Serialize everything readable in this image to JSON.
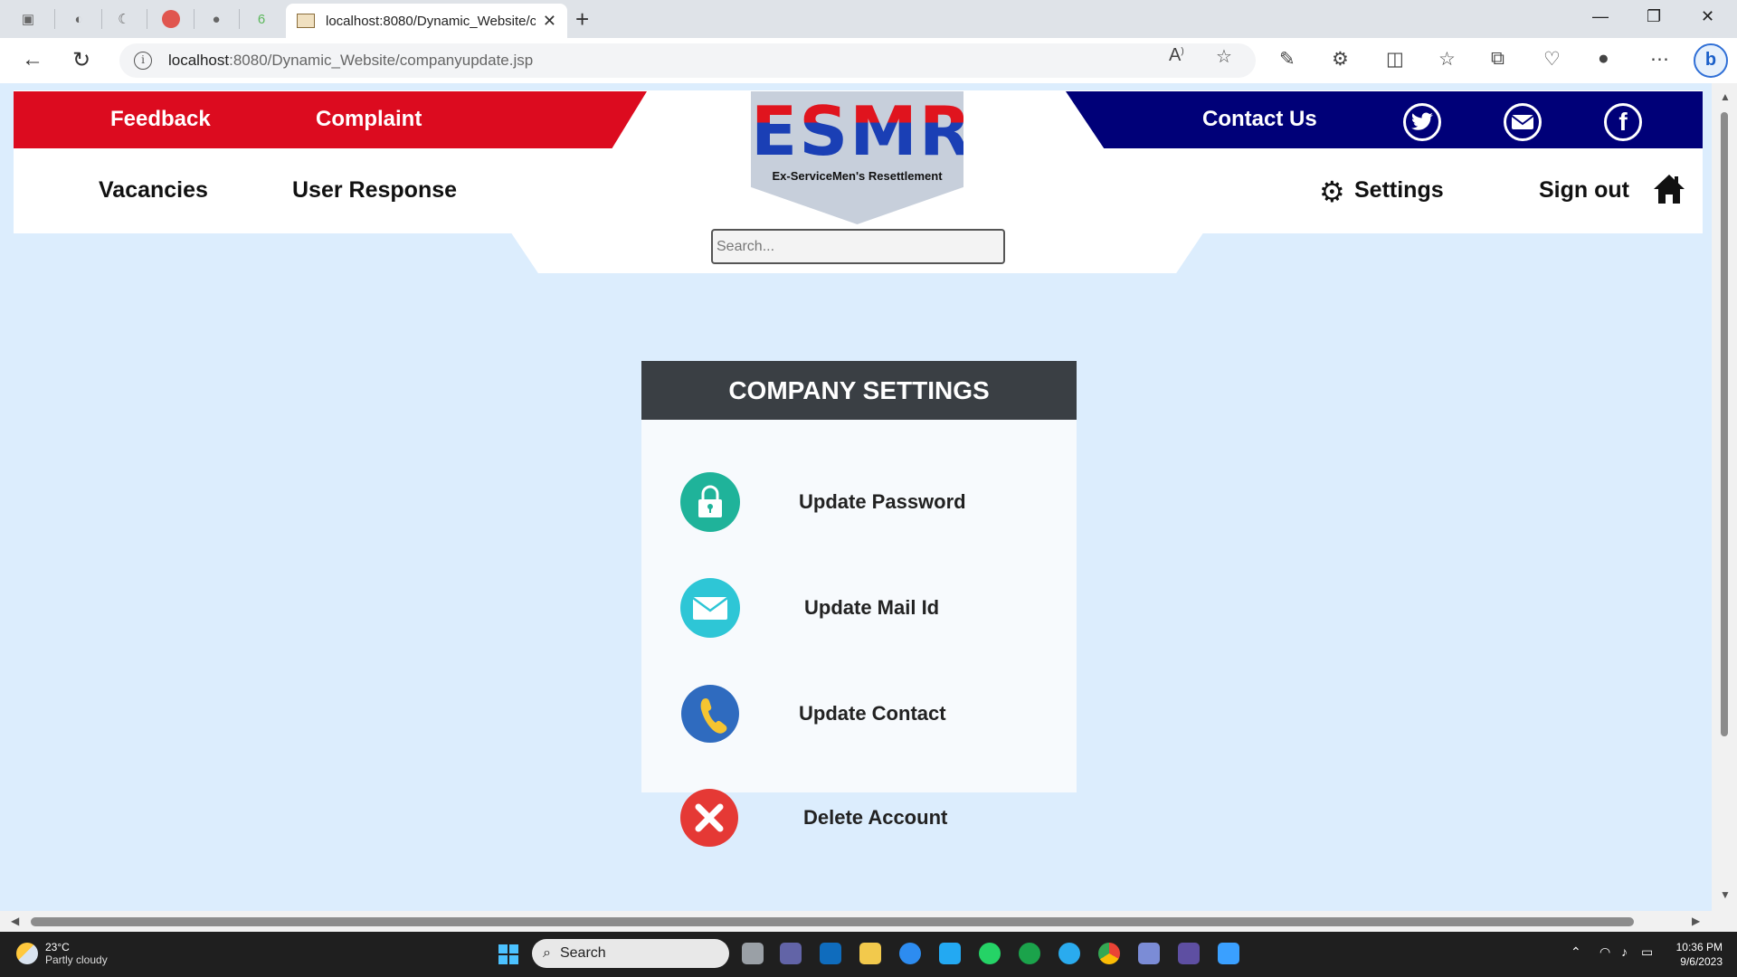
{
  "browser": {
    "tab_title": "localhost:8080/Dynamic_Website/companyupdate.jsp",
    "url_host": "localhost",
    "url_path": ":8080/Dynamic_Website/companyupdate.jsp"
  },
  "header": {
    "feedback": "Feedback",
    "complaint": "Complaint",
    "contact": "Contact Us",
    "logo_text": "ESMR",
    "logo_sub": "Ex-ServiceMen's Resettlement",
    "vacancies": "Vacancies",
    "user_response": "User Response",
    "settings": "Settings",
    "signout": "Sign out",
    "search_placeholder": "Search..."
  },
  "card": {
    "title": "COMPANY SETTINGS",
    "options": [
      {
        "label": "Update Password",
        "icon": "lock-icon",
        "color": "#1fb39a"
      },
      {
        "label": "Update Mail Id",
        "icon": "mail-icon",
        "color": "#2ec6d6"
      },
      {
        "label": "Update Contact",
        "icon": "phone-icon",
        "color": "#2f6bbf"
      },
      {
        "label": "Delete Account",
        "icon": "close-icon",
        "color": "#e53935"
      }
    ]
  },
  "taskbar": {
    "temp": "23°C",
    "weather": "Partly cloudy",
    "search": "Search",
    "time": "10:36 PM",
    "date": "9/6/2023"
  },
  "colors": {
    "red_band": "#dc0b1f",
    "blue_band": "#000078",
    "page_bg": "#dcedfd",
    "card_head": "#3a3f44"
  }
}
